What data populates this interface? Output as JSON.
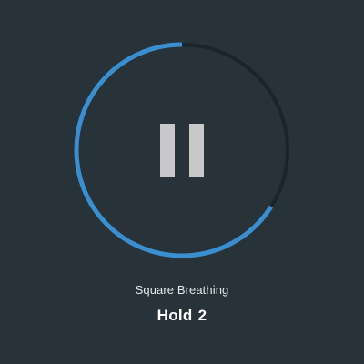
{
  "session": {
    "exercise_title": "Square Breathing",
    "phase_label": "Hold",
    "phase_count": "2",
    "progress_fraction": 0.66
  },
  "colors": {
    "background": "#273239",
    "progress_arc": "#3a8fd0",
    "track": "#1b2429",
    "pause_icon": "#c8c8c8"
  },
  "icons": {
    "control": "pause-icon"
  }
}
